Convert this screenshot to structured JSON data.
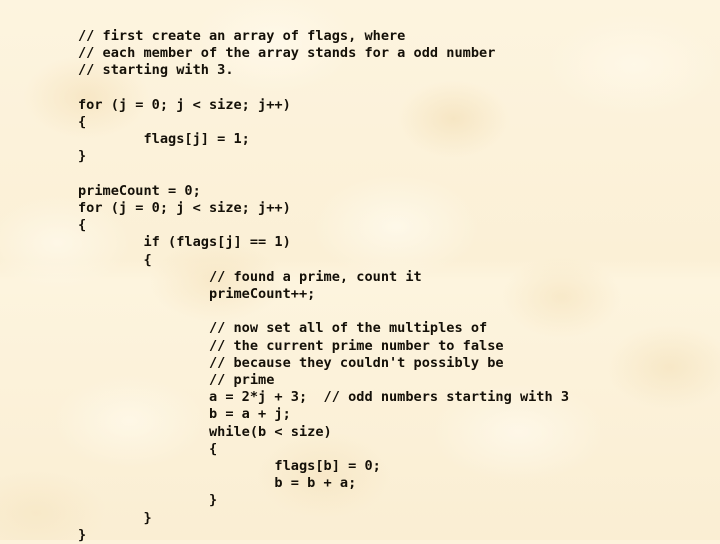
{
  "slide": {
    "background_color": "#fcf2db",
    "text_color": "#141008",
    "code_language": "c",
    "code_lines": [
      "// first create an array of flags, where",
      "// each member of the array stands for a odd number",
      "// starting with 3.",
      "",
      "for (j = 0; j < size; j++)",
      "{",
      "        flags[j] = 1;",
      "}",
      "",
      "primeCount = 0;",
      "for (j = 0; j < size; j++)",
      "{",
      "        if (flags[j] == 1)",
      "        {",
      "                // found a prime, count it",
      "                primeCount++;",
      "",
      "                // now set all of the multiples of",
      "                // the current prime number to false",
      "                // because they couldn't possibly be",
      "                // prime",
      "                a = 2*j + 3;  // odd numbers starting with 3",
      "                b = a + j;",
      "                while(b < size)",
      "                {",
      "                        flags[b] = 0;",
      "                        b = b + a;",
      "                }",
      "        }",
      "}"
    ]
  }
}
